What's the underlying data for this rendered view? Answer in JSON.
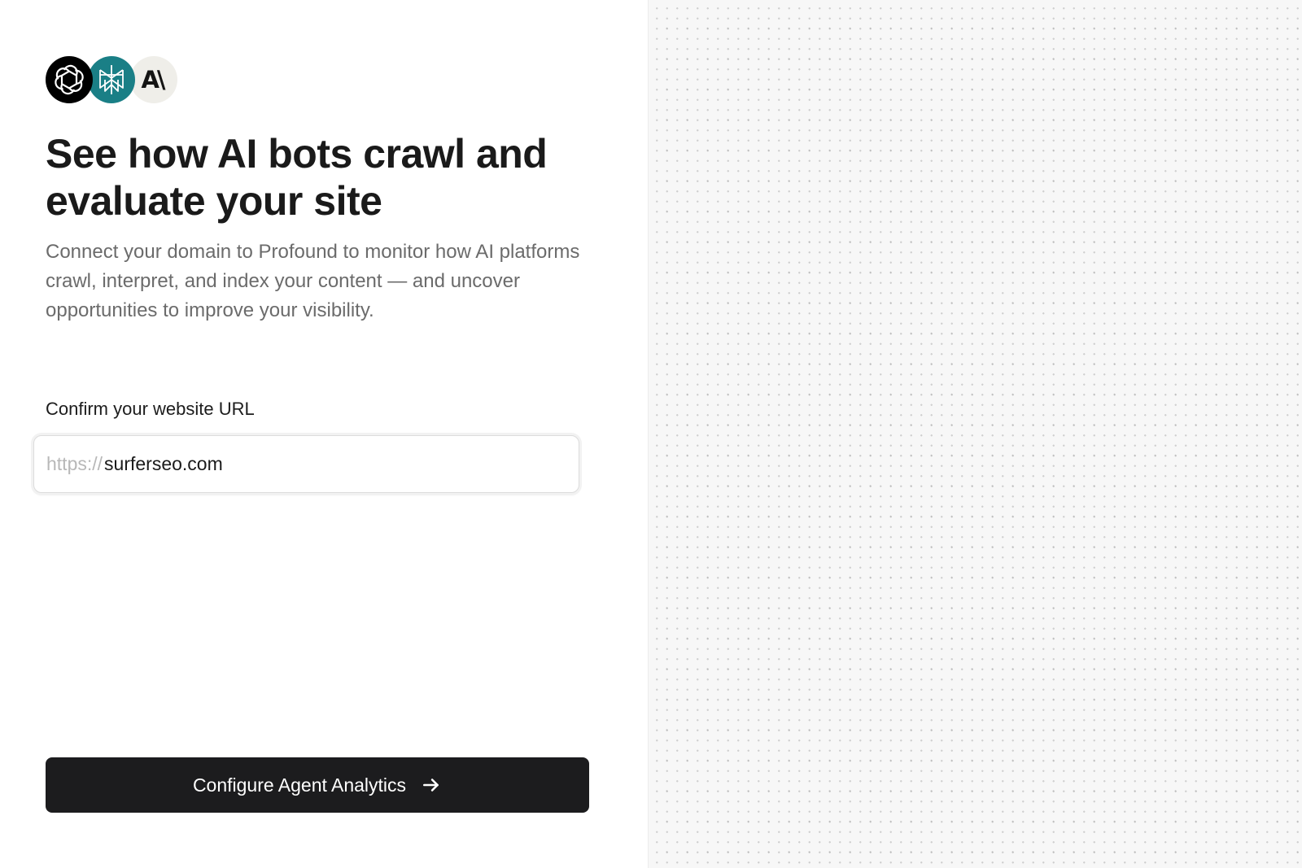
{
  "logos": [
    {
      "name": "openai-logo-icon"
    },
    {
      "name": "perplexity-logo-icon"
    },
    {
      "name": "anthropic-logo-icon",
      "text": "A\\"
    }
  ],
  "hero": {
    "title": "See how AI bots crawl and evaluate your site",
    "description": "Connect your domain to Profound to monitor how AI platforms crawl, interpret, and index your content — and uncover opportunities to improve your visibility."
  },
  "url_form": {
    "label": "Confirm your website URL",
    "prefix": "https://",
    "value": "surferseo.com"
  },
  "cta": {
    "label": "Configure Agent Analytics",
    "icon": "arrow-right-icon"
  },
  "colors": {
    "button_bg": "#1c1c1e",
    "perplexity_teal": "#1a7f86",
    "anthropic_bg": "#efeee9",
    "openai_bg": "#000000",
    "dotted_panel_bg": "#f7f7f7"
  }
}
